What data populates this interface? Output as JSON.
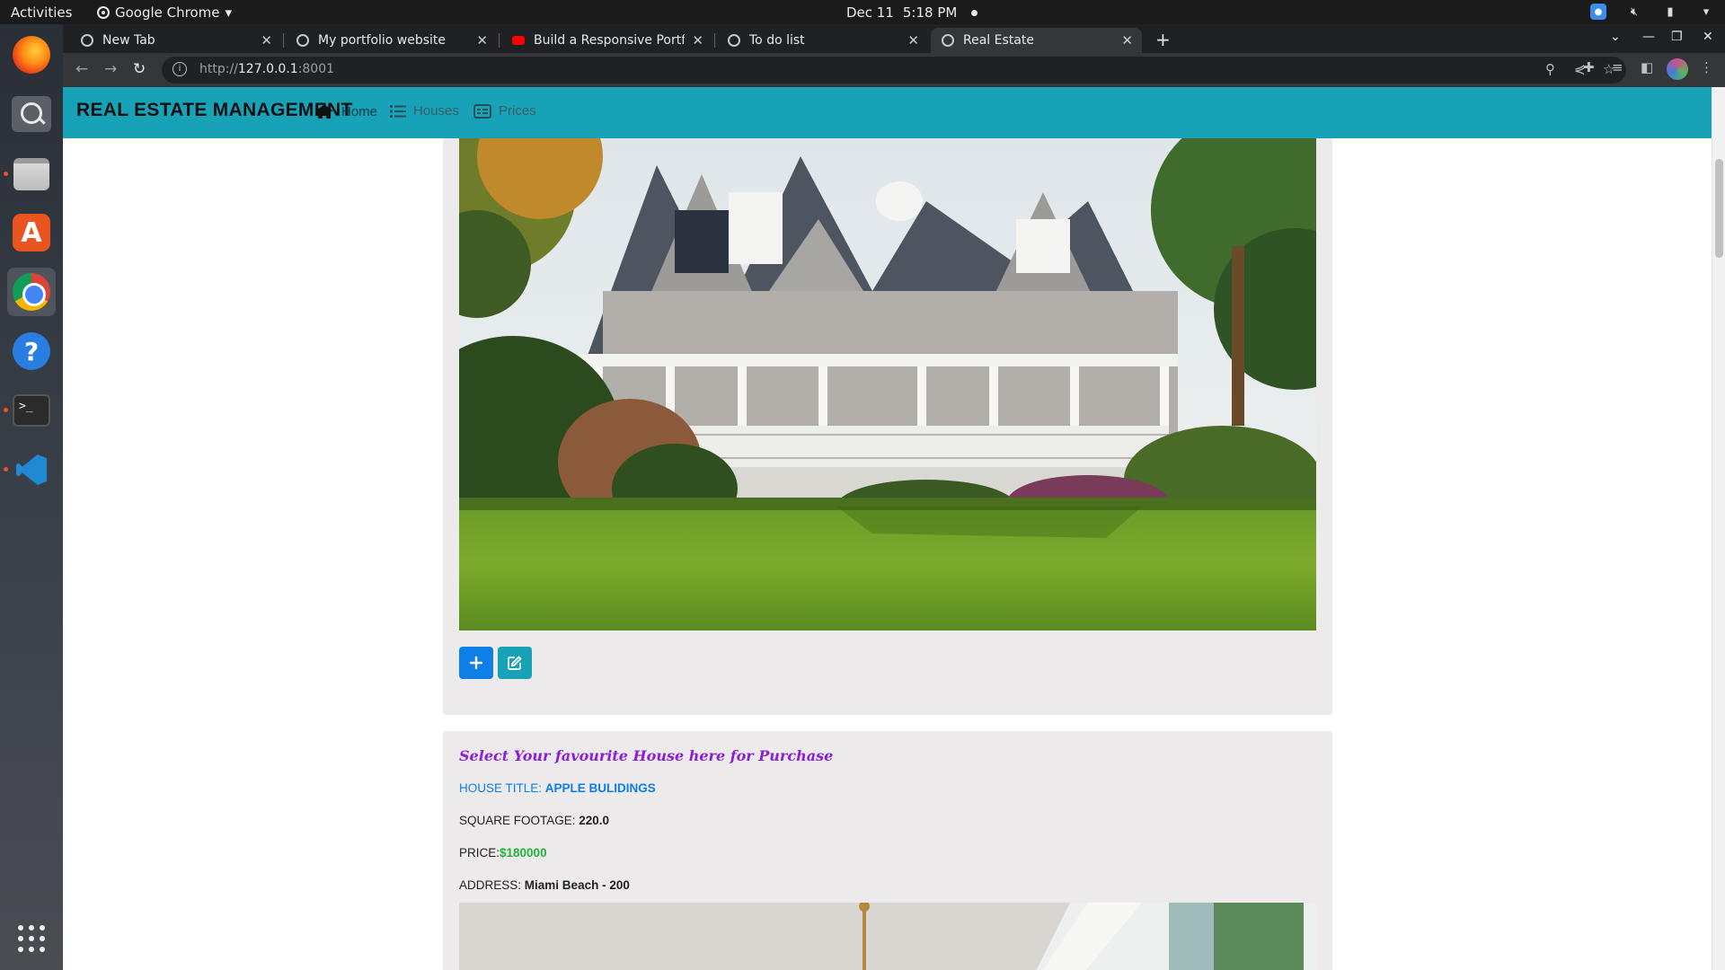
{
  "system": {
    "activities": "Activities",
    "app_name": "Google Chrome",
    "date": "Dec 11",
    "time": "5:18 PM"
  },
  "browser": {
    "tabs": [
      {
        "title": "New Tab"
      },
      {
        "title": "My portfolio website"
      },
      {
        "title": "Build a Responsive Portfo"
      },
      {
        "title": "To do list"
      },
      {
        "title": "Real Estate",
        "active": true
      }
    ],
    "url_prefix": "http://",
    "url_host": "127.0.0.1",
    "url_port": ":8001"
  },
  "site": {
    "brand": "REAL ESTATE MANAGEMENT",
    "nav": {
      "home": "Home",
      "houses": "Houses",
      "prices": "Prices"
    },
    "accent_color": "#17a2b8"
  },
  "listing": {
    "heading": "Select Your favourite House here for Purchase",
    "title_label": "HOUSE TITLE:",
    "title_value": "APPLE BULIDINGS",
    "sqft_label": "SQUARE FOOTAGE:",
    "sqft_value": "220.0",
    "price_label": "PRICE:",
    "price_value": "$180000",
    "address_label": "ADDRESS:",
    "address_value": "Miami Beach - 200"
  }
}
